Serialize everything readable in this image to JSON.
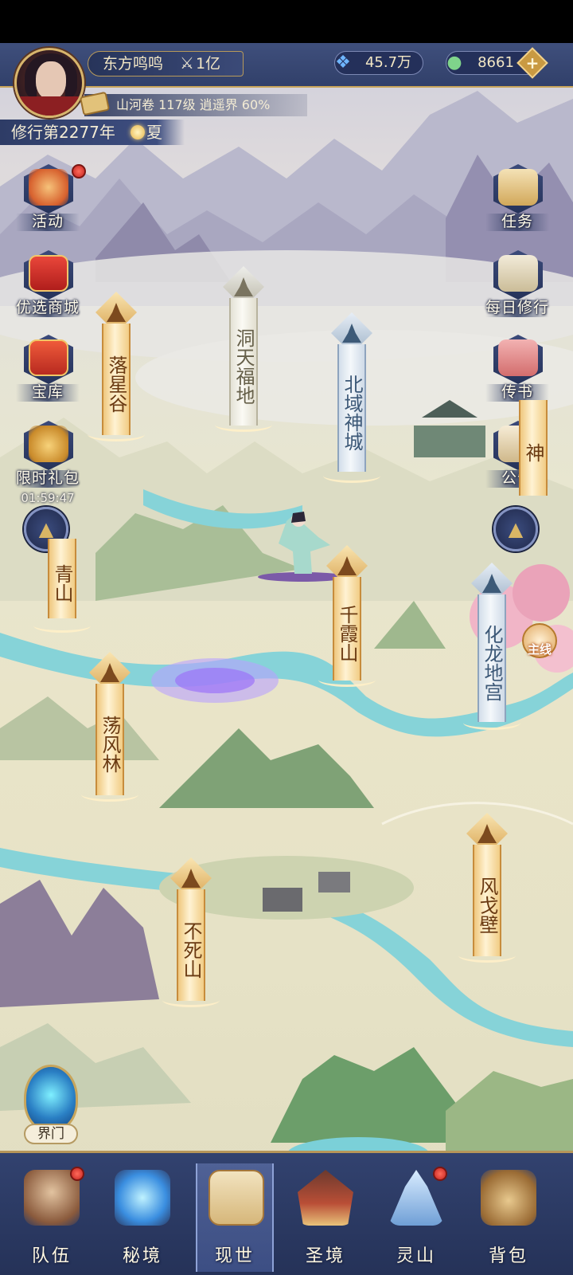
{
  "player": {
    "name": "东方鸣鸣",
    "power": "1亿",
    "realm_info": "山河卷 117级 逍遥界 60%"
  },
  "currencies": {
    "spirit_crystal": "45.7万",
    "jade": "8661",
    "plus": "+"
  },
  "time": {
    "year": "修行第2277年",
    "season": "夏"
  },
  "left_menu": [
    {
      "label": "活动",
      "icon": "lantern-icon",
      "badge": true
    },
    {
      "label": "优选商城",
      "icon": "gift-chest-icon",
      "badge": false
    },
    {
      "label": "宝库",
      "icon": "treasure-chest-icon",
      "badge": false
    },
    {
      "label": "限时礼包",
      "icon": "money-bag-icon",
      "badge": false
    }
  ],
  "limited_pack_timer": "01:59:47",
  "right_menu": [
    {
      "label": "任务",
      "icon": "scroll-icon"
    },
    {
      "label": "每日修行",
      "icon": "book-icon"
    },
    {
      "label": "传书",
      "icon": "letter-icon"
    },
    {
      "label": "公告",
      "icon": "notice-icon"
    }
  ],
  "locations": [
    {
      "name": "落星谷",
      "style": "gold"
    },
    {
      "name": "洞天福地",
      "style": "grey"
    },
    {
      "name": "北域神城",
      "style": "blue"
    },
    {
      "name": "青山",
      "style": "gold"
    },
    {
      "name": "千霞山",
      "style": "gold"
    },
    {
      "name": "化龙地宫",
      "style": "blue"
    },
    {
      "name": "荡风林",
      "style": "gold"
    },
    {
      "name": "风戈壁",
      "style": "gold"
    },
    {
      "name": "不死山",
      "style": "gold"
    },
    {
      "name": "神",
      "style": "gold"
    }
  ],
  "main_quest": "主线",
  "portal": {
    "label": "界门"
  },
  "nav": [
    {
      "label": "队伍",
      "icon": "team-icon",
      "badge": true,
      "active": false
    },
    {
      "label": "秘境",
      "icon": "vortex-icon",
      "badge": false,
      "active": false
    },
    {
      "label": "现世",
      "icon": "world-map-icon",
      "badge": false,
      "active": true
    },
    {
      "label": "圣境",
      "icon": "palace-icon",
      "badge": false,
      "active": false
    },
    {
      "label": "灵山",
      "icon": "mountain-icon",
      "badge": true,
      "active": false
    },
    {
      "label": "背包",
      "icon": "bag-icon",
      "badge": false,
      "active": false
    }
  ],
  "colors": {
    "hud": "#31406a",
    "gold": "#d9a552",
    "river": "#7ccfd6",
    "badge": "#c42521"
  }
}
